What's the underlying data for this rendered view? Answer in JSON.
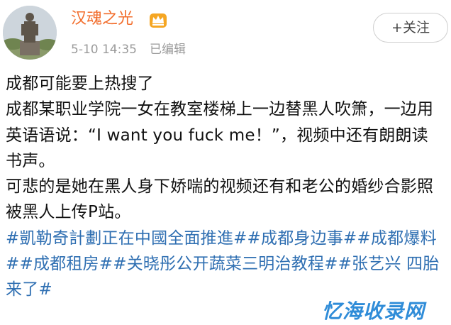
{
  "header": {
    "username": "汉魂之光",
    "vip_icon": "crown-vip-icon",
    "timestamp": "5-10 14:35",
    "edited": "已编辑",
    "follow_label": "+关注"
  },
  "post": {
    "paragraphs": [
      "成都可能要上热搜了",
      "成都某职业学院一女在教室楼梯上一边替黑人吹箫，一边用英语语说：“I want you fuck me！”，视频中还有朗朗读书声。",
      "可悲的是她在黑人身下娇喘的视频还有和老公的婚纱合影照被黑人上传P站。"
    ],
    "tags": [
      "#凱勒奇計劃正在中國全面推進#",
      "#成都身边事#",
      "#成都爆料#",
      "#成都租房#",
      "#关晓彤公开蔬菜三明治教程#",
      "#张艺兴 四胎来了#"
    ]
  },
  "watermark": {
    "text": "忆海收录网"
  },
  "colors": {
    "username": "#f26d2c",
    "meta": "#9a9a9a",
    "tag_link": "#2f6fb2",
    "watermark": "#2f8cd8",
    "follow_border": "#cfcfcf"
  }
}
